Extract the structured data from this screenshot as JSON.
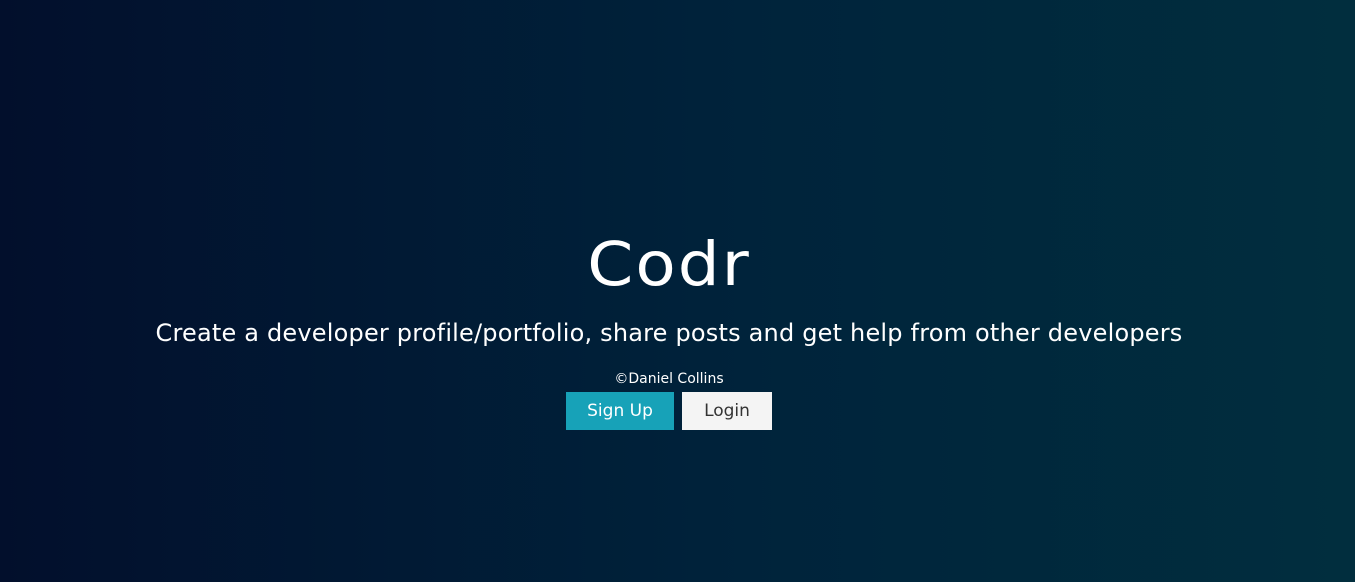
{
  "landing": {
    "title": "Codr",
    "lead": "Create a developer profile/portfolio, share posts and get help from other developers",
    "copyright": "©Daniel Collins",
    "buttons": {
      "signup_label": "Sign Up",
      "login_label": "Login"
    }
  },
  "colors": {
    "primary_button": "#17a2b8",
    "light_button": "#f4f4f4",
    "text": "#ffffff",
    "background_left": "#020f2c",
    "background_right": "#012e3e"
  }
}
